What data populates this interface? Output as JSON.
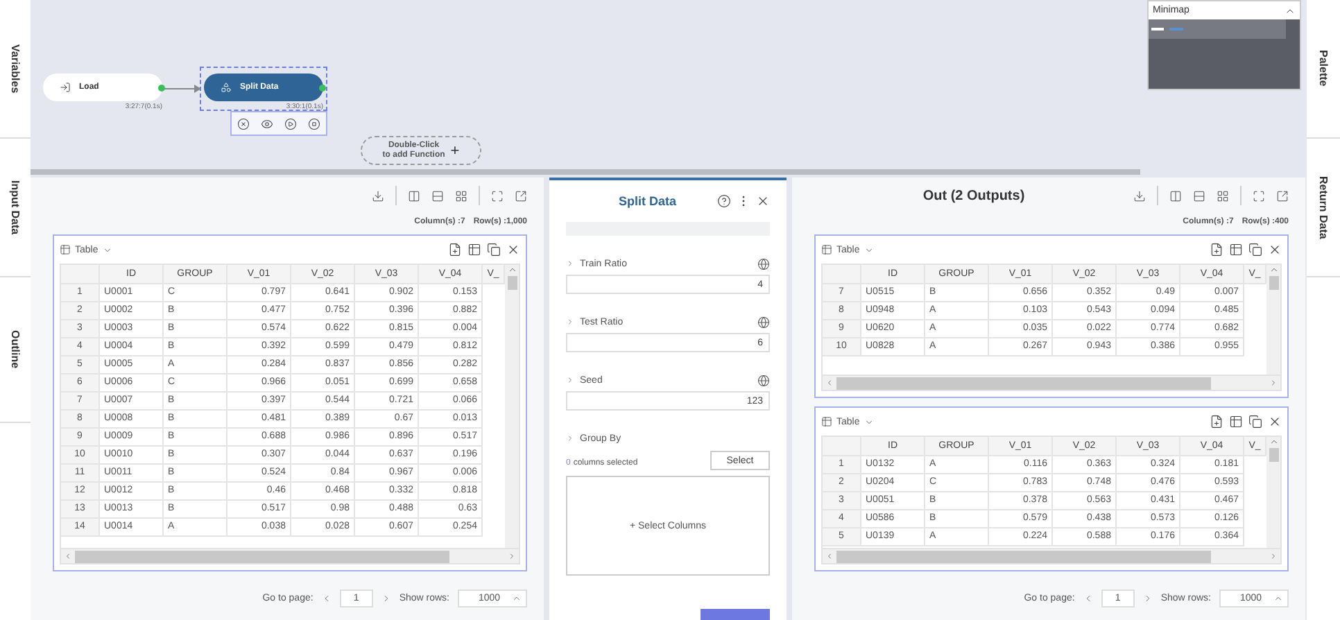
{
  "side_tabs_left": [
    {
      "label": "Variables"
    },
    {
      "label": "Input Data"
    },
    {
      "label": "Outline"
    }
  ],
  "side_tabs_right": [
    {
      "label": "Palette"
    },
    {
      "label": "Return Data"
    }
  ],
  "canvas": {
    "nodes": [
      {
        "kind": "source",
        "label": "Load",
        "time": "3:27:7(0.1s)",
        "selected": false
      },
      {
        "kind": "function",
        "label": "Split Data",
        "time": "3:30:1(0.1s)",
        "selected": true
      }
    ],
    "add_hint": "Double-Click\nto add Function",
    "add_symbol": "+"
  },
  "minimap": {
    "title": "Minimap"
  },
  "input_panel": {
    "columns_count": "Column(s) :7",
    "rows_count": "Row(s) :1,000",
    "table": {
      "view": "Table",
      "columns": [
        "ID",
        "GROUP",
        "V_01",
        "V_02",
        "V_03",
        "V_04",
        "V_"
      ],
      "rows": [
        {
          "index": "1",
          "cells": [
            "U0001",
            "C",
            "0.797",
            "0.641",
            "0.902",
            "0.153"
          ]
        },
        {
          "index": "2",
          "cells": [
            "U0002",
            "B",
            "0.477",
            "0.752",
            "0.396",
            "0.882"
          ]
        },
        {
          "index": "3",
          "cells": [
            "U0003",
            "B",
            "0.574",
            "0.622",
            "0.815",
            "0.004"
          ]
        },
        {
          "index": "4",
          "cells": [
            "U0004",
            "B",
            "0.392",
            "0.599",
            "0.479",
            "0.812"
          ]
        },
        {
          "index": "5",
          "cells": [
            "U0005",
            "A",
            "0.284",
            "0.837",
            "0.856",
            "0.282"
          ]
        },
        {
          "index": "6",
          "cells": [
            "U0006",
            "C",
            "0.966",
            "0.051",
            "0.699",
            "0.658"
          ]
        },
        {
          "index": "7",
          "cells": [
            "U0007",
            "B",
            "0.397",
            "0.544",
            "0.721",
            "0.066"
          ]
        },
        {
          "index": "8",
          "cells": [
            "U0008",
            "B",
            "0.481",
            "0.389",
            "0.67",
            "0.013"
          ]
        },
        {
          "index": "9",
          "cells": [
            "U0009",
            "B",
            "0.688",
            "0.986",
            "0.896",
            "0.517"
          ]
        },
        {
          "index": "10",
          "cells": [
            "U0010",
            "B",
            "0.307",
            "0.044",
            "0.637",
            "0.196"
          ]
        },
        {
          "index": "11",
          "cells": [
            "U0011",
            "B",
            "0.524",
            "0.84",
            "0.967",
            "0.006"
          ]
        },
        {
          "index": "12",
          "cells": [
            "U0012",
            "B",
            "0.46",
            "0.468",
            "0.332",
            "0.818"
          ]
        },
        {
          "index": "13",
          "cells": [
            "U0013",
            "B",
            "0.517",
            "0.98",
            "0.488",
            "0.63"
          ]
        },
        {
          "index": "14",
          "cells": [
            "U0014",
            "A",
            "0.038",
            "0.028",
            "0.607",
            "0.254"
          ]
        }
      ]
    },
    "pager": {
      "page_label": "Go to page:",
      "page": "1",
      "rows_label": "Show rows:",
      "rows": "1000"
    }
  },
  "function_panel": {
    "title": "Split Data",
    "params": [
      {
        "label": "Train Ratio",
        "value": "4"
      },
      {
        "label": "Test Ratio",
        "value": "6"
      },
      {
        "label": "Seed",
        "value": "123"
      }
    ],
    "group_by": {
      "label": "Group By",
      "count": "0",
      "count_text": "columns selected",
      "button": "Select",
      "add": "+ Select Columns"
    }
  },
  "output_panel": {
    "title": "Out (2 Outputs)",
    "columns_count": "Column(s) :7",
    "rows_count": "Row(s) :400",
    "tables": [
      {
        "view": "Table",
        "columns": [
          "ID",
          "GROUP",
          "V_01",
          "V_02",
          "V_03",
          "V_04",
          "V_"
        ],
        "rows": [
          {
            "index": "7",
            "cells": [
              "U0515",
              "B",
              "0.656",
              "0.352",
              "0.49",
              "0.007"
            ]
          },
          {
            "index": "8",
            "cells": [
              "U0948",
              "A",
              "0.103",
              "0.543",
              "0.094",
              "0.485"
            ]
          },
          {
            "index": "9",
            "cells": [
              "U0620",
              "A",
              "0.035",
              "0.022",
              "0.774",
              "0.682"
            ]
          },
          {
            "index": "10",
            "cells": [
              "U0828",
              "A",
              "0.267",
              "0.943",
              "0.386",
              "0.955"
            ]
          }
        ]
      },
      {
        "view": "Table",
        "columns": [
          "ID",
          "GROUP",
          "V_01",
          "V_02",
          "V_03",
          "V_04",
          "V_"
        ],
        "rows": [
          {
            "index": "1",
            "cells": [
              "U0132",
              "A",
              "0.116",
              "0.363",
              "0.324",
              "0.181"
            ]
          },
          {
            "index": "2",
            "cells": [
              "U0204",
              "C",
              "0.783",
              "0.748",
              "0.476",
              "0.593"
            ]
          },
          {
            "index": "3",
            "cells": [
              "U0051",
              "B",
              "0.378",
              "0.563",
              "0.431",
              "0.467"
            ]
          },
          {
            "index": "4",
            "cells": [
              "U0586",
              "B",
              "0.579",
              "0.438",
              "0.573",
              "0.126"
            ]
          },
          {
            "index": "5",
            "cells": [
              "U0139",
              "A",
              "0.224",
              "0.588",
              "0.176",
              "0.364"
            ]
          }
        ]
      }
    ],
    "pager": {
      "page_label": "Go to page:",
      "page": "1",
      "rows_label": "Show rows:",
      "rows": "1000"
    }
  }
}
